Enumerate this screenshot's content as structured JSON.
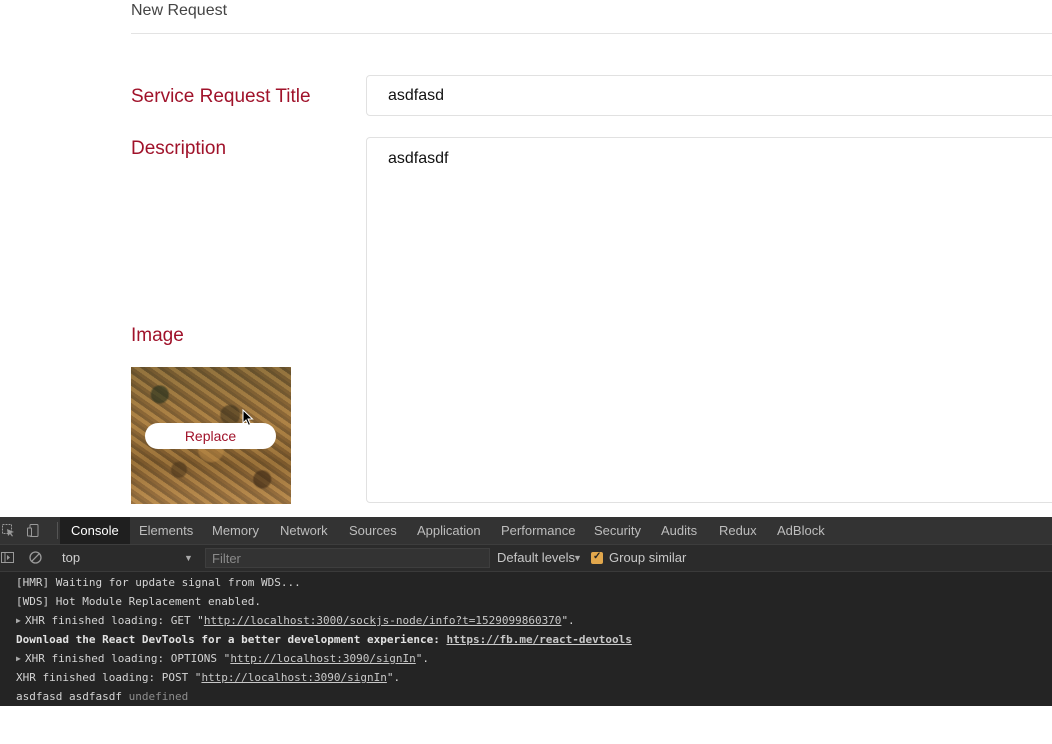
{
  "page": {
    "title": "New Request",
    "labels": {
      "service_request_title": "Service Request Title",
      "description": "Description",
      "image": "Image"
    },
    "fields": {
      "title_value": "asdfasd",
      "description_value": "asdfasdf"
    },
    "replace_button": "Replace",
    "accent_color": "#a0122a"
  },
  "devtools": {
    "tabs": [
      "Console",
      "Elements",
      "Memory",
      "Network",
      "Sources",
      "Application",
      "Performance",
      "Security",
      "Audits",
      "Redux",
      "AdBlock"
    ],
    "active_tab": "Console",
    "context": "top",
    "filter_placeholder": "Filter",
    "levels": "Default levels",
    "group_similar": "Group similar",
    "group_similar_checked": true,
    "logs": [
      {
        "text": "[HMR] Waiting for update signal from WDS..."
      },
      {
        "text": "[WDS] Hot Module Replacement enabled."
      },
      {
        "prefix": "XHR finished loading: GET \"",
        "link": "http://localhost:3000/sockjs-node/info?t=1529099860370",
        "suffix": "\"."
      },
      {
        "prefix": "Download the React DevTools for a better development experience: ",
        "link": "https://fb.me/react-devtools",
        "suffix": ""
      },
      {
        "prefix": "XHR finished loading: OPTIONS \"",
        "link": "http://localhost:3090/signIn",
        "suffix": "\"."
      },
      {
        "prefix": "XHR finished loading: POST \"",
        "link": "http://localhost:3090/signIn",
        "suffix": "\"."
      },
      {
        "text": "asdfasd asdfasdf",
        "muted": "undefined"
      }
    ]
  }
}
